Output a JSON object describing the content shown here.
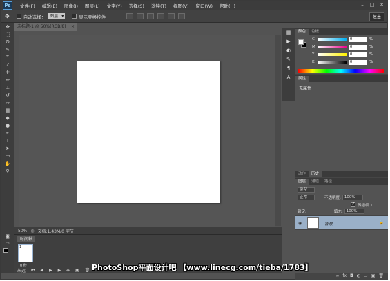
{
  "app": {
    "logo": "Ps"
  },
  "menu": [
    "文件(F)",
    "编辑(E)",
    "图像(I)",
    "图层(L)",
    "文字(Y)",
    "选择(S)",
    "滤镜(T)",
    "视图(V)",
    "窗口(W)",
    "帮助(H)"
  ],
  "options_bar": {
    "auto_select_label": "自动选择：",
    "auto_select_value": "图层",
    "show_transform_label": "显示变换控件",
    "workspace": "基本"
  },
  "document": {
    "tab_title": "未标题-1 @ 50%(RGB/8)",
    "zoom": "50%",
    "doc_info": "文档:1.43M/0 字节"
  },
  "timeline": {
    "tab_label": "时间轴",
    "frame_number": "1",
    "frame_delay": "0 秒",
    "loop_value": "永远"
  },
  "color_panel": {
    "tabs": [
      "颜色",
      "色板"
    ],
    "channels": [
      {
        "label": "C",
        "value": "0",
        "unit": "%"
      },
      {
        "label": "M",
        "value": "0",
        "unit": "%"
      },
      {
        "label": "Y",
        "value": "0",
        "unit": "%"
      },
      {
        "label": "K",
        "value": "0",
        "unit": "%"
      }
    ]
  },
  "properties_panel": {
    "tab": "属性",
    "text": "无属性"
  },
  "history_tabs": [
    "动作",
    "历史"
  ],
  "layers_panel": {
    "tabs": [
      "图层",
      "通道",
      "路径"
    ],
    "filter_kind": "类型",
    "blend_mode": "正常",
    "opacity_label": "不透明度:",
    "opacity_value": "100%",
    "lock_label": "锁定:",
    "fill_label": "填充:",
    "fill_value": "100%",
    "propagate_label": "传播帧 1",
    "unify_label": "统一:",
    "layer_name": "背景"
  },
  "watermark": "PhotoShop平面设计吧 【www.linecg.com/tieba/1783】",
  "colors": {
    "chrome": "#535353",
    "dark": "#3d3d3d",
    "layer_selected": "#9ab0c8"
  }
}
